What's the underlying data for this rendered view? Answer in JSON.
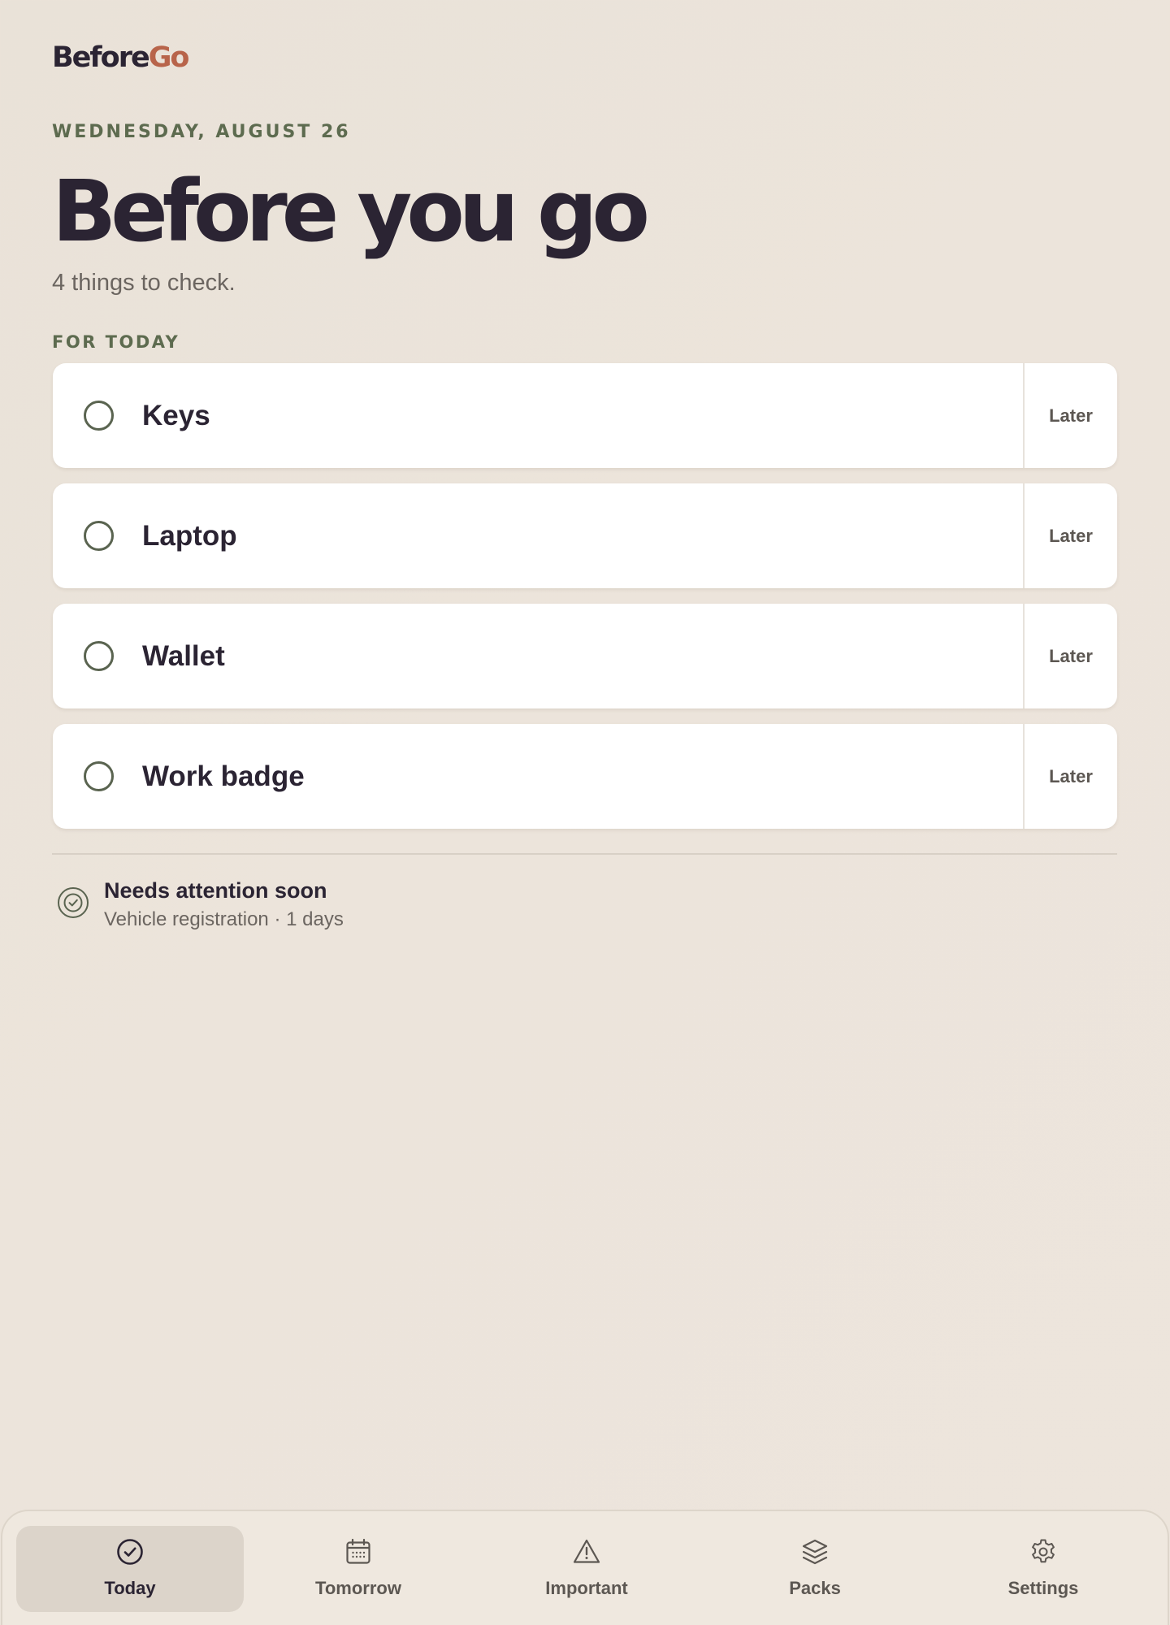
{
  "brand": {
    "part1": "Before",
    "part2": "Go"
  },
  "header": {
    "date": "WEDNESDAY, AUGUST 26",
    "title": "Before you go",
    "subtitle": "4 things to check."
  },
  "section": {
    "label": "FOR TODAY"
  },
  "items": [
    {
      "label": "Keys",
      "action": "Later"
    },
    {
      "label": "Laptop",
      "action": "Later"
    },
    {
      "label": "Wallet",
      "action": "Later"
    },
    {
      "label": "Work badge",
      "action": "Later"
    }
  ],
  "attention": {
    "title": "Needs attention soon",
    "detail": "Vehicle registration · 1 days",
    "icon": "check-badge-icon"
  },
  "tabs": [
    {
      "label": "Today",
      "icon": "check-circle-icon",
      "active": true
    },
    {
      "label": "Tomorrow",
      "icon": "calendar-icon",
      "active": false
    },
    {
      "label": "Important",
      "icon": "warning-icon",
      "active": false
    },
    {
      "label": "Packs",
      "icon": "layers-icon",
      "active": false
    },
    {
      "label": "Settings",
      "icon": "gear-icon",
      "active": false
    }
  ],
  "colors": {
    "accent": "#b8644a",
    "ink": "#2b2433",
    "olive": "#5d6b4f",
    "background": "#ece4db"
  }
}
